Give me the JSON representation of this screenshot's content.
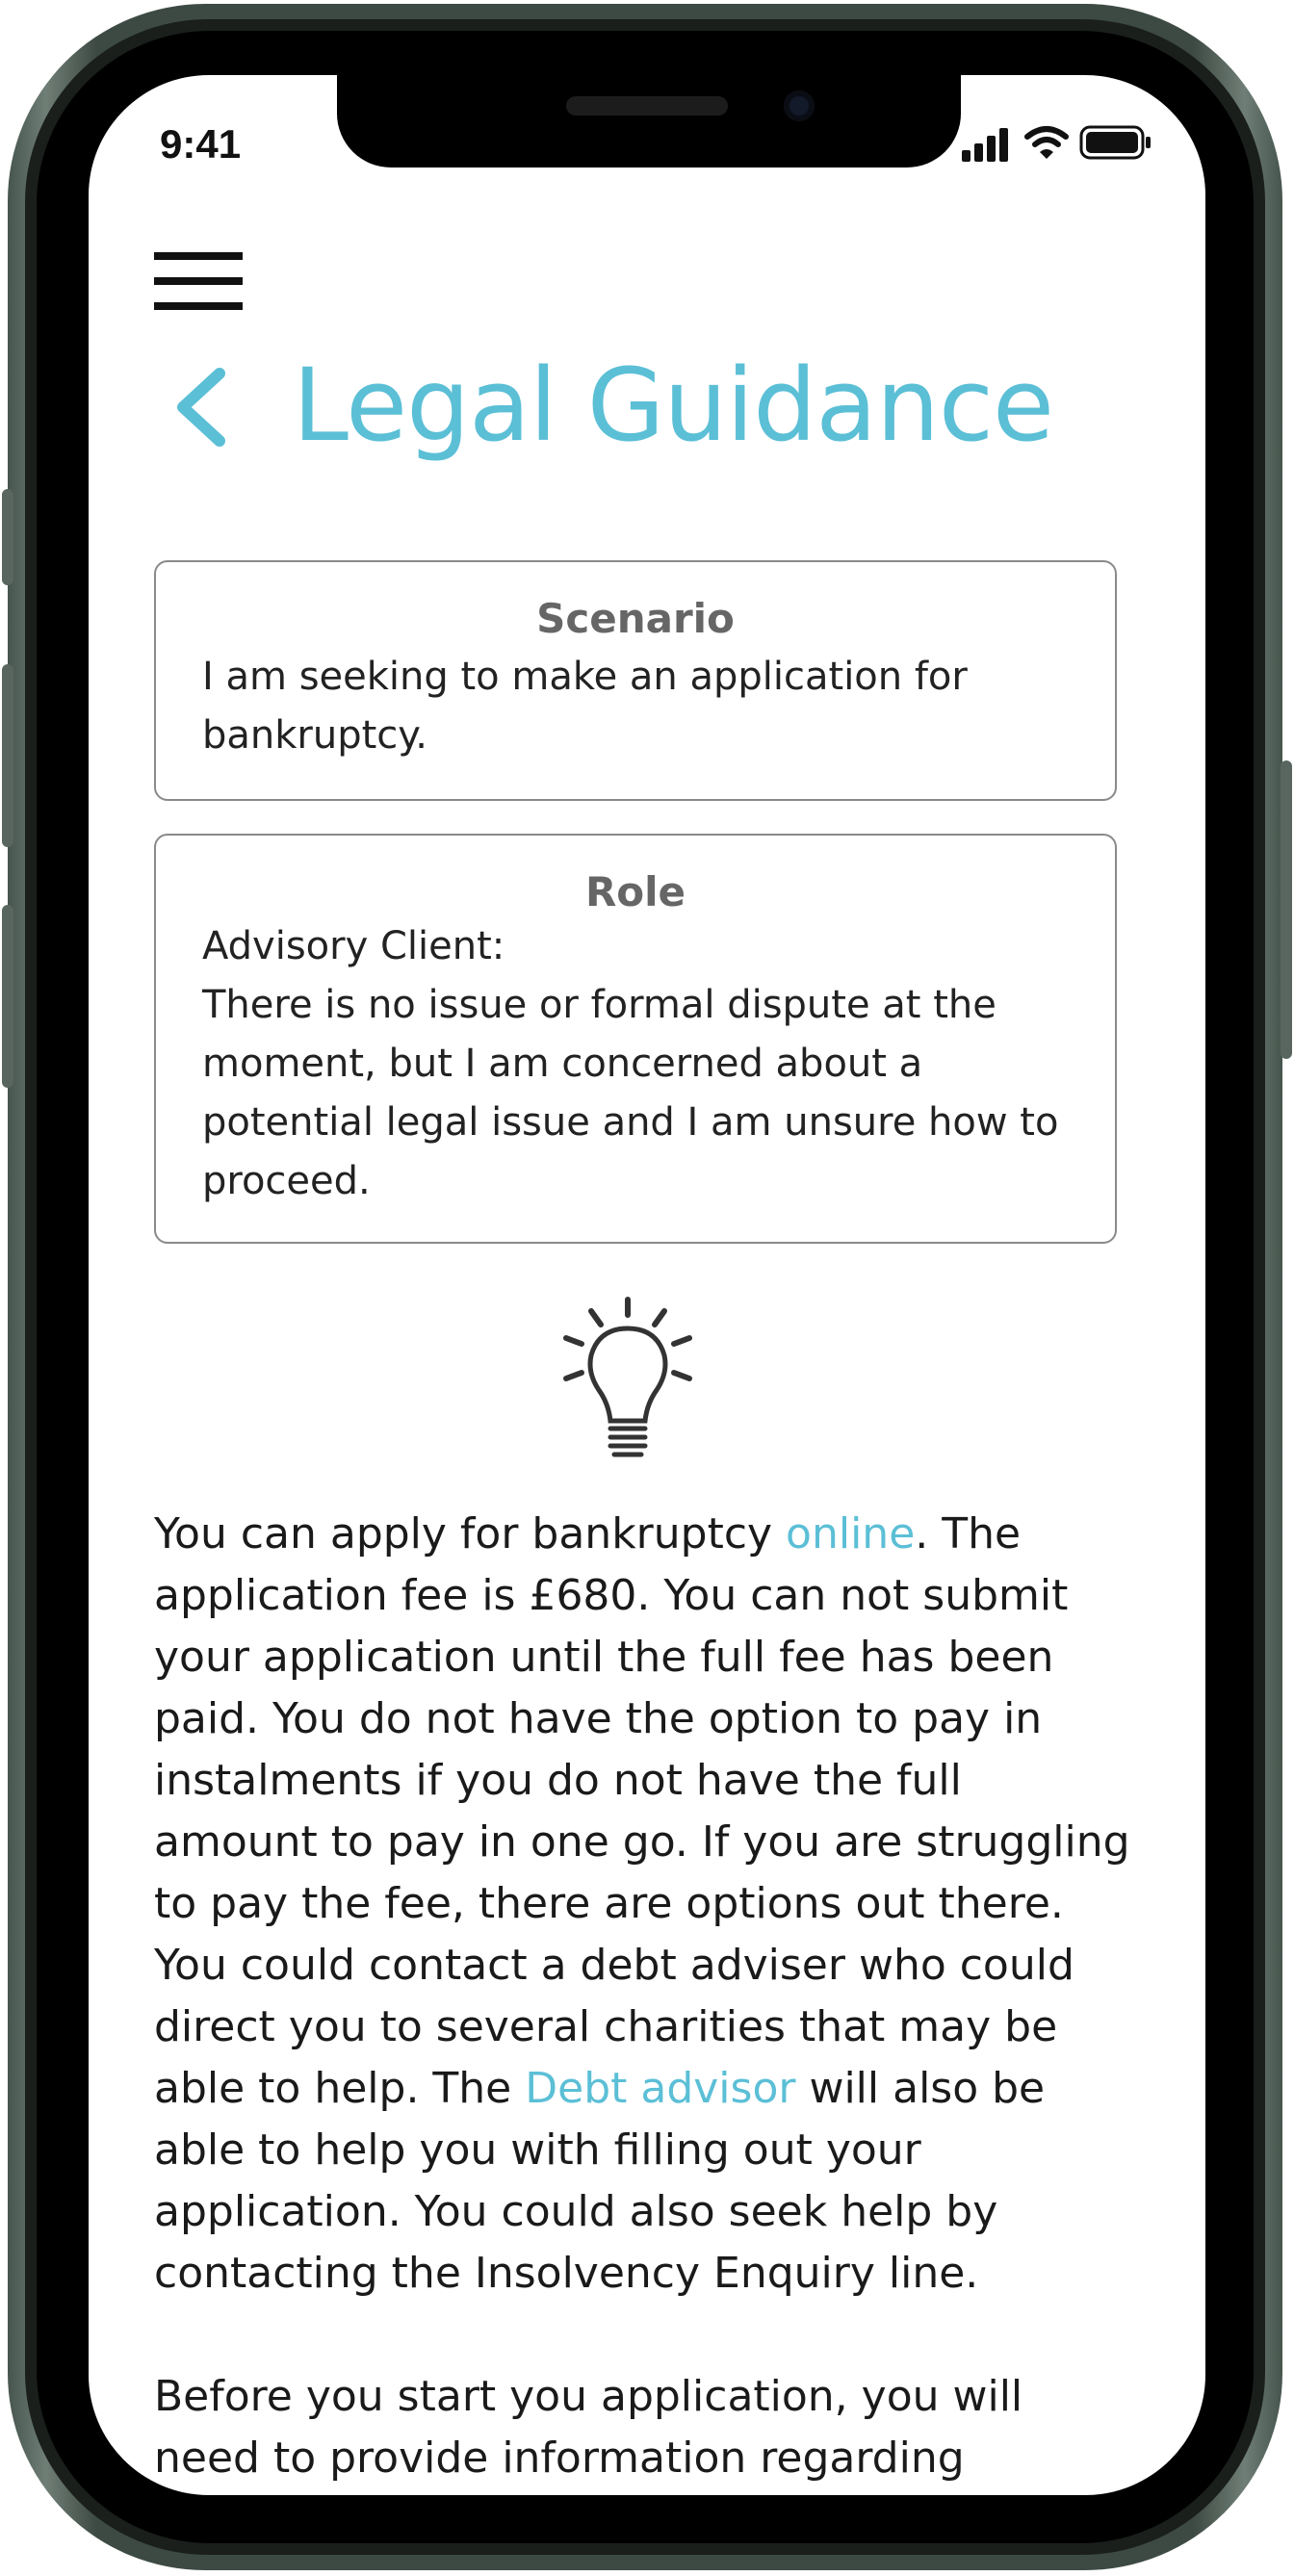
{
  "status_bar": {
    "time": "9:41",
    "icons": [
      "signal-icon",
      "wifi-icon",
      "battery-icon"
    ]
  },
  "header": {
    "back_icon": "chevron-left-icon",
    "title": "Legal Guidance"
  },
  "scenario_card": {
    "title": "Scenario",
    "body": "I am seeking to make an application for bankruptcy."
  },
  "role_card": {
    "title": "Role",
    "body": "Advisory Client:\nThere is no issue or formal dispute at the moment, but I am concerned about a potential legal issue and I am unsure how to proceed."
  },
  "tip_icon": "lightbulb-icon",
  "guidance": {
    "p1_a": "You can apply for bankruptcy ",
    "p1_link_online": "online",
    "p1_b": ". The application fee is £680. You can not submit your application until the full fee has been paid. You do not have the option to pay in instalments if you do not have the full amount to pay in one go. If you are struggling to pay the fee, there are options out there. You could contact a debt adviser who could direct you to several charities that may be able to help. The ",
    "p1_link_debt": "Debt advisor",
    "p1_c": " will also be able to help you with filling out your application. You could also seek help by contacting the Insolvency Enquiry line.",
    "p2": "Before you start you application, you will need to provide information regarding"
  },
  "colors": {
    "accent": "#5bbfd6",
    "frame": "#3d4a43",
    "card_border": "#8a8a8a"
  }
}
